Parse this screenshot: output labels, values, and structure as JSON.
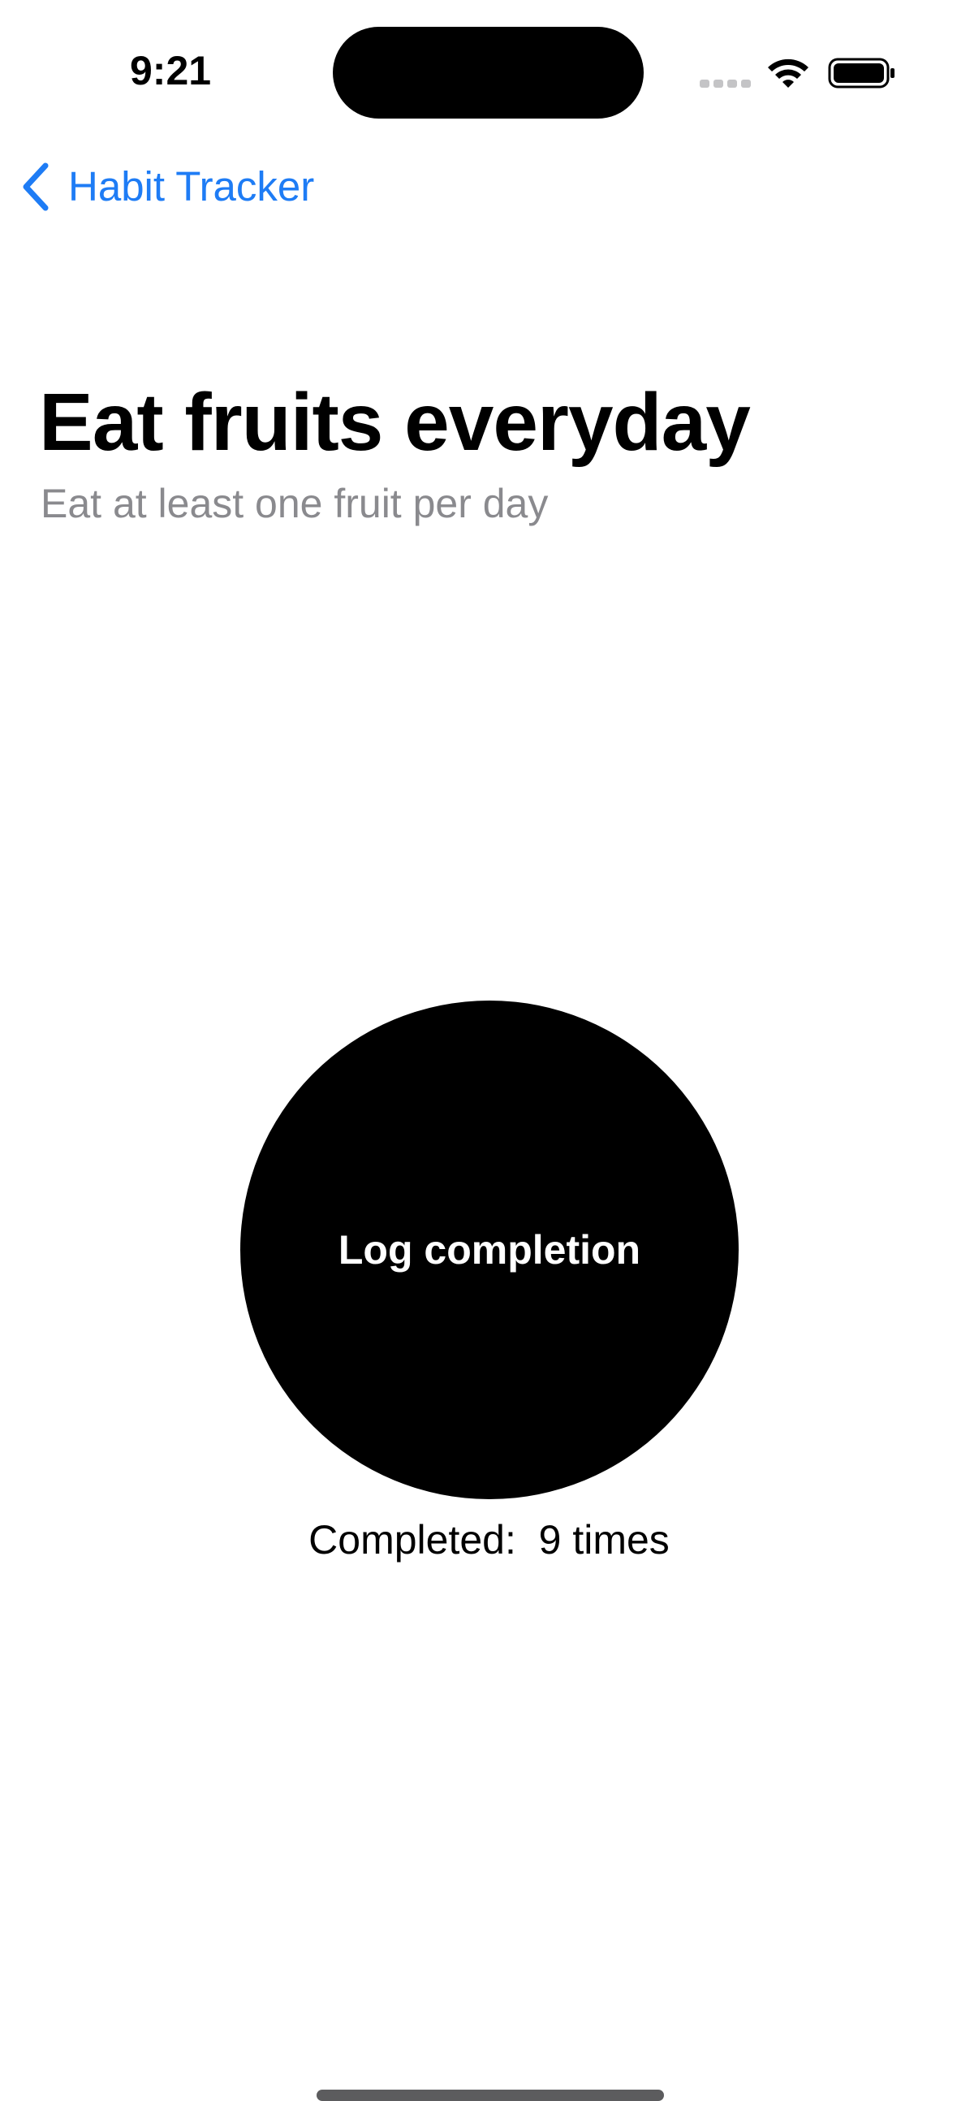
{
  "status_bar": {
    "time": "9:21"
  },
  "nav": {
    "back_label": "Habit Tracker"
  },
  "habit": {
    "title": "Eat fruits everyday",
    "description": "Eat at least one fruit per day"
  },
  "log_button": {
    "label": "Log completion"
  },
  "completion": {
    "prefix": "Completed:",
    "count": 9,
    "text": "Completed:  9 times"
  },
  "colors": {
    "accent": "#1e7cf5",
    "subtitle": "#8a8a8e",
    "button_bg": "#000000",
    "button_text": "#ffffff"
  },
  "icons": {
    "back": "chevron-left-icon",
    "wifi": "wifi-icon",
    "battery": "battery-icon",
    "signal": "cellular-signal-icon"
  }
}
